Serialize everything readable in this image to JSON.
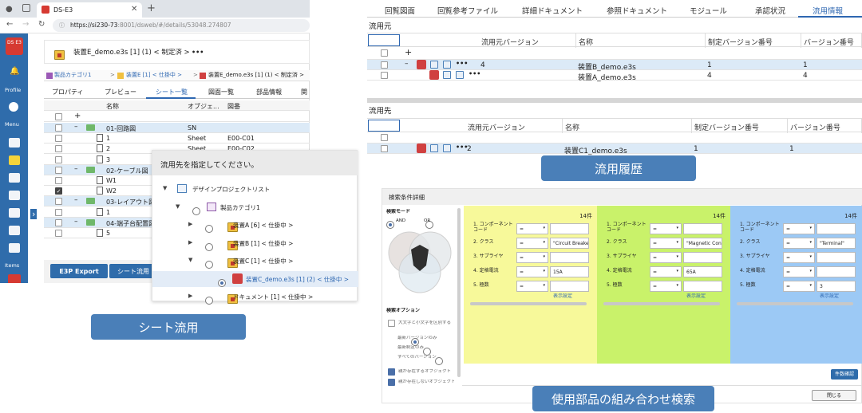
{
  "browser": {
    "tab_title": "DS-E3",
    "url_host": "https://si230-73",
    "url_rest": ":8001/dsweb/#/details/53048.274807"
  },
  "sidebar": {
    "logo": "DS E3",
    "profile": "Profile",
    "menu": "Menu",
    "items": "Items"
  },
  "left_app": {
    "header_title": "装置E_demo.e3s [1] (1) < 制定済 >",
    "more": "•••",
    "breadcrumb": [
      "製品カテゴリ1",
      "装置E [1] < 仕掛中 >",
      "装置E_demo.e3s [1] (1) < 制定済 >"
    ],
    "tabs": [
      "プロパティ",
      "プレビュー",
      "シート一覧",
      "図面一覧",
      "部品情報",
      "関"
    ],
    "active_tab": "シート一覧",
    "columns": [
      "名称",
      "オブジェ...",
      "図番"
    ],
    "rows": [
      {
        "name": "01-回路図",
        "type": "SN",
        "no": "",
        "kind": "folder",
        "checked": false
      },
      {
        "name": "1",
        "type": "Sheet",
        "no": "E00-C01",
        "kind": "doc",
        "checked": false
      },
      {
        "name": "2",
        "type": "Sheet",
        "no": "E00-C02",
        "kind": "doc",
        "checked": false
      },
      {
        "name": "3",
        "type": "",
        "no": "",
        "kind": "doc",
        "checked": false
      },
      {
        "name": "02-ケーブル図",
        "type": "",
        "no": "",
        "kind": "folder",
        "checked": false
      },
      {
        "name": "W1",
        "type": "",
        "no": "",
        "kind": "doc",
        "checked": false
      },
      {
        "name": "W2",
        "type": "",
        "no": "",
        "kind": "doc",
        "checked": true
      },
      {
        "name": "03-レイアウト図",
        "type": "",
        "no": "",
        "kind": "folder",
        "checked": false
      },
      {
        "name": "1",
        "type": "",
        "no": "",
        "kind": "doc",
        "checked": false
      },
      {
        "name": "04-端子台配置図",
        "type": "",
        "no": "",
        "kind": "folder",
        "checked": false
      },
      {
        "name": "5",
        "type": "",
        "no": "",
        "kind": "doc",
        "checked": false
      }
    ],
    "button_export": "E3P Export",
    "button_sheet": "シート流用"
  },
  "popup": {
    "title": "流用先を指定してください。",
    "tree": [
      {
        "label": "デザインプロジェクトリスト",
        "level": 0,
        "arrow": "▼",
        "radio": false
      },
      {
        "label": "製品カテゴリ1",
        "level": 1,
        "arrow": "▼",
        "radio": true
      },
      {
        "label": "装置A [6] < 仕掛中 >",
        "level": 2,
        "arrow": "▶",
        "radio": true
      },
      {
        "label": "装置B [1] < 仕掛中 >",
        "level": 2,
        "arrow": "▶",
        "radio": true
      },
      {
        "label": "装置C [1] < 仕掛中 >",
        "level": 2,
        "arrow": "▼",
        "radio": true
      },
      {
        "label": "装置C_demo.e3s [1] (2) < 仕掛中 >",
        "level": 3,
        "arrow": "",
        "radio": true,
        "selected": true
      },
      {
        "label": "ドキュメント [1] < 仕掛中 >",
        "level": 2,
        "arrow": "▶",
        "radio": true
      }
    ]
  },
  "caption_sheet": "シート流用",
  "right_app": {
    "tabs": [
      "回覧図面",
      "回覧参考ファイル",
      "詳細ドキュメント",
      "参照ドキュメント",
      "モジュール",
      "承認状況",
      "流用情報"
    ],
    "active_tab": "流用情報",
    "source_label": "流用元",
    "source_columns": [
      "流用元バージョン",
      "名称",
      "制定バージョン番号",
      "バージョン番号"
    ],
    "source_rows": [
      {
        "ver": "4",
        "name": "装置B_demo.e3s",
        "fixed": "1",
        "version": "1"
      },
      {
        "ver": "",
        "name": "装置A_demo.e3s",
        "fixed": "4",
        "version": "4"
      }
    ],
    "dest_label": "流用先",
    "dest_columns": [
      "流用元バージョン",
      "名称",
      "制定バージョン番号",
      "バージョン番号"
    ],
    "dest_rows": [
      {
        "ver": "2",
        "name": "装置C1_demo.e3s",
        "fixed": "1",
        "version": "1"
      }
    ]
  },
  "caption_history": "流用履歴",
  "search": {
    "title": "検索条件詳細",
    "mode_label": "検索モード",
    "and": "AND",
    "or": "OR",
    "options_label": "検索オプション",
    "opt_case": "大文字と小文字を区別する",
    "radio_options": [
      "最新バージョンのみ",
      "最新制定のみ",
      "すべてのバージョン"
    ],
    "check_options": [
      "親が存在するオブジェクト",
      "親が存在しないオブジェクト"
    ],
    "panels": [
      {
        "count": "14件",
        "color": "#f7f99a",
        "values": [
          "",
          "\"Circuit Breake",
          "",
          "15A",
          ""
        ]
      },
      {
        "count": "14件",
        "color": "#c9f26a",
        "values": [
          "",
          "\"Magnetic Con",
          "",
          "65A",
          ""
        ]
      },
      {
        "count": "14件",
        "color": "#9cc9f5",
        "values": [
          "",
          "\"Terminal\"",
          "",
          "",
          "3"
        ]
      }
    ],
    "field_labels": [
      "1. コンポーネントコード",
      "2. クラス",
      "3. サプライヤ",
      "4. 定格電流",
      "5. 極数"
    ],
    "eq": "=",
    "display_settings": "表示設定",
    "count_button": "件数確認",
    "close_button": "閉じる"
  },
  "caption_search": "使用部品の組み合わせ検索"
}
